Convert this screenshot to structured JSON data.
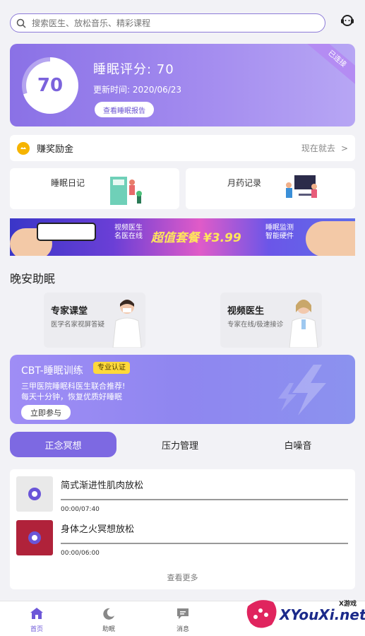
{
  "search": {
    "placeholder": "搜索医生、放松音乐、精彩课程"
  },
  "score": {
    "value": "70",
    "value_fraction": 0.7,
    "title": "睡眠评分:  70",
    "updated": "更新时间:  2020/06/23",
    "report_button": "查看睡眠报告",
    "status_ribbon": "已连接"
  },
  "reward": {
    "label": "赚奖励金",
    "action": "现在就去",
    "chevron": ">"
  },
  "records": {
    "diary": "睡眠日记",
    "medication": "月药记录"
  },
  "banner": {
    "left_text_1": "视频医生",
    "left_text_2": "名医在线",
    "center_text": "超值套餐 ¥3.99",
    "right_text_1": "睡眠监测",
    "right_text_2": "智能硬件"
  },
  "section": {
    "title": "晚安助眠"
  },
  "services": {
    "expert": {
      "title": "专家课堂",
      "desc": "医学名家视屏答疑"
    },
    "video": {
      "title": "视频医生",
      "desc": "专家在线/极速接诊"
    }
  },
  "cbt": {
    "title": "CBT-睡眠训练",
    "badge": "专业认证",
    "line1": "三甲医院睡眠科医生联合推荐!",
    "line2": "每天十分钟，恢复优质好睡眠",
    "join_button": "立即参与"
  },
  "tabs": [
    {
      "label": "正念冥想",
      "active": true
    },
    {
      "label": "压力管理",
      "active": false
    },
    {
      "label": "白噪音",
      "active": false
    }
  ],
  "tracks": [
    {
      "name": "简式渐进性肌肉放松",
      "time": "00:00/07:40"
    },
    {
      "name": "身体之火冥想放松",
      "time": "00:00/06:00"
    }
  ],
  "more": "查看更多",
  "nav": {
    "home": "首页",
    "sleep": "助眠",
    "messages": "消息"
  },
  "watermark": {
    "small": "X游戏",
    "big": "XYouXi.net"
  },
  "colors": {
    "accent": "#7d69e2",
    "card_gradient_start": "#8a71e6",
    "badge": "#ffd93b",
    "coin": "#f6b400"
  }
}
